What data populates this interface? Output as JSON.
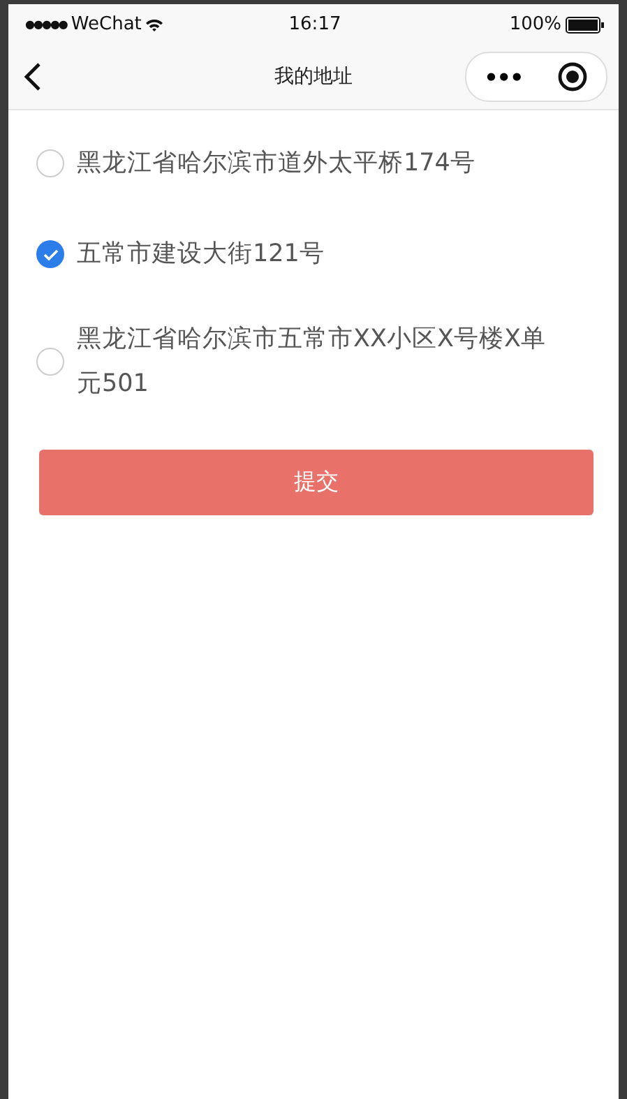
{
  "status_bar": {
    "signal_dots": "●●●●●",
    "carrier": "WeChat",
    "time": "16:17",
    "battery": "100%"
  },
  "nav": {
    "title": "我的地址",
    "more": "•••"
  },
  "addresses": [
    {
      "text": "黑龙江省哈尔滨市道外太平桥174号",
      "selected": false
    },
    {
      "text": "五常市建设大街121号",
      "selected": true
    },
    {
      "text": "黑龙江省哈尔滨市五常市XX小区X号楼X单元501",
      "selected": false
    }
  ],
  "submit": "提交"
}
